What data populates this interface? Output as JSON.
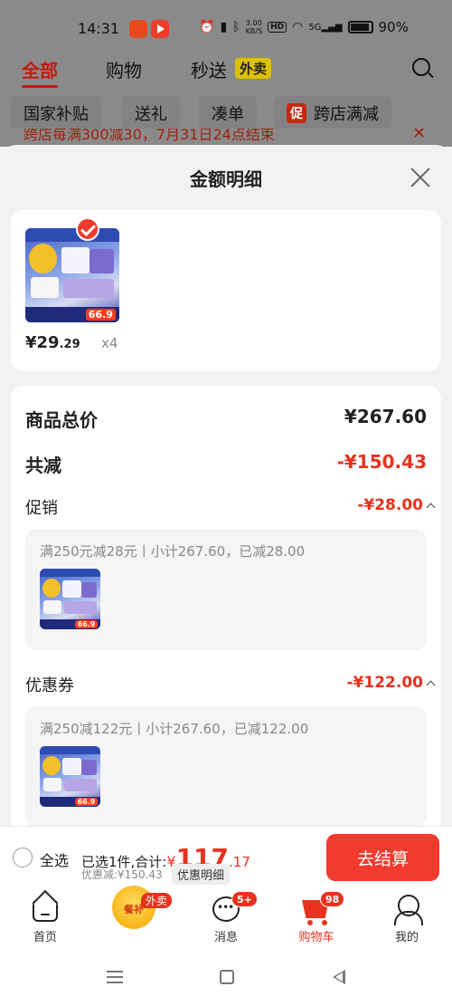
{
  "status_bar": {
    "time": "14:31",
    "net_speed_value": "3.00",
    "net_speed_unit": "KB/S",
    "hd": "HD",
    "signal": "5G",
    "battery": "90%"
  },
  "top_tabs": {
    "all": "全部",
    "shopping": "购物",
    "express": "秒送",
    "express_tag": "外卖"
  },
  "chips": [
    "国家补贴",
    "送礼",
    "凑单",
    "跨店满减"
  ],
  "chip_promo_icon": "促",
  "banner_text": "跨店每满300减30，7月31日24点结束",
  "sheet": {
    "title": "金额明细",
    "product": {
      "price_symbol": "¥",
      "price_int": "29",
      "price_dec": ".29",
      "qty": "x4",
      "img_price": "66.9"
    },
    "total_label": "商品总价",
    "total_value": "¥267.60",
    "reduce_label": "共减",
    "reduce_value": "-¥150.43",
    "promo_label": "促销",
    "promo_value": "-¥28.00",
    "promo_detail": "满250元减28元丨小计267.60，已减28.00",
    "coupon_label": "优惠券",
    "coupon_value": "-¥122.00",
    "coupon_detail": "满250减122元丨小计267.60，已减122.00"
  },
  "footer": {
    "select_all": "全选",
    "selected_text": "已选1件,合计:",
    "total_symbol": "¥",
    "total_int": "117",
    "total_dec": ".17",
    "discount_text": "优惠减:¥150.43",
    "detail_button": "优惠明细",
    "checkout_button": "去结算"
  },
  "tabbar": {
    "home": "首页",
    "subsidy_icon_text": "餐补",
    "subsidy_badge": "外卖",
    "messages": "消息",
    "messages_badge": "5+",
    "cart": "购物车",
    "cart_badge": "98",
    "me": "我的"
  },
  "colors": {
    "accent": "#e8321e",
    "checkout": "#f23a2e",
    "overlay": "#8a8a8a"
  }
}
